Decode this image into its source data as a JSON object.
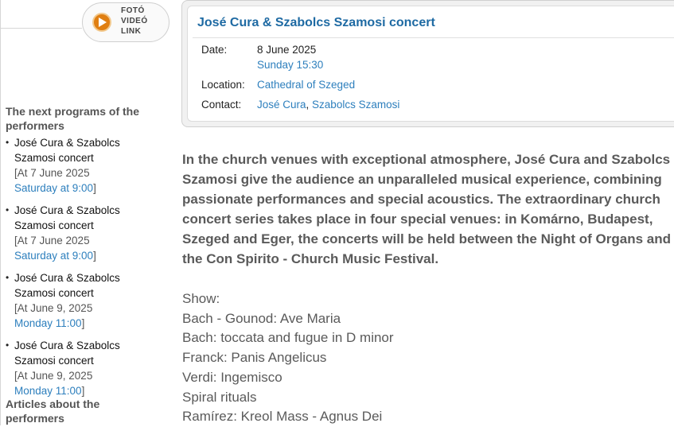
{
  "media": {
    "line1": "FOTÓ",
    "line2": "VIDEÓ",
    "line3": "LINK"
  },
  "sidebar": {
    "next_title": "The next programs of the performers",
    "programs": [
      {
        "name": "José Cura & Szabolcs Szamosi concert",
        "date": "[At 7 June 2025",
        "day": "Saturday at 9:00",
        "close": "]"
      },
      {
        "name": "José Cura & Szabolcs Szamosi concert",
        "date": "[At 7 June 2025",
        "day": "Saturday at 9:00",
        "close": "]"
      },
      {
        "name": "José Cura & Szabolcs Szamosi concert",
        "date": "[At June 9, 2025",
        "day": "Monday 11:00",
        "close": "]"
      },
      {
        "name": "José Cura & Szabolcs Szamosi concert",
        "date": "[At June 9, 2025",
        "day": "Monday 11:00",
        "close": "]"
      }
    ],
    "articles_title": "Articles about the performers"
  },
  "event": {
    "title": "José Cura & Szabolcs Szamosi concert",
    "date_label": "Date:",
    "date": "8 June 2025",
    "day_time": "Sunday 15:30",
    "location_label": "Location:",
    "location": "Cathedral of Szeged",
    "contact_label": "Contact:",
    "contact_1": "José Cura",
    "contact_sep": ", ",
    "contact_2": "Szabolcs Szamosi"
  },
  "description": "In the church venues with exceptional atmosphere, José Cura and Szabolcs Szamosi give the audience an unparalleled musical experience, combining passionate performances and special acoustics. The extraordinary church concert series takes place in four special venues: in Komárno, Budapest, Szeged and Eger, the concerts will be held between the Night of Organs and the Con Spirito - Church Music Festival.",
  "show": {
    "label": "Show:",
    "items": [
      "Bach - Gounod: Ave Maria",
      "Bach: toccata and fugue in D minor",
      "Franck: Panis Angelicus",
      "Verdi: Ingemisco",
      "Spiral rituals",
      "Ramírez: Kreol Mass - Agnus Dei"
    ]
  },
  "colors": {
    "link": "#2d7fbd",
    "title": "#1e6aa3",
    "accent": "#e07f12"
  }
}
